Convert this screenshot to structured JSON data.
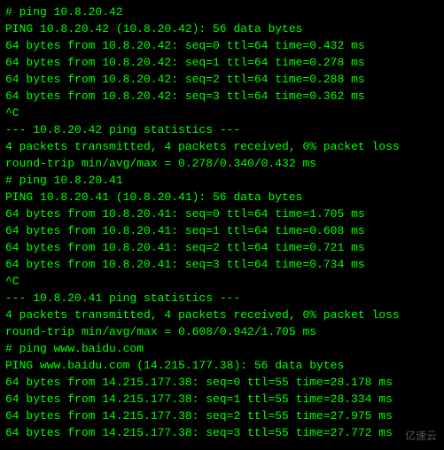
{
  "terminal": {
    "lines": [
      "# ping 10.8.20.42",
      "PING 10.8.20.42 (10.8.20.42): 56 data bytes",
      "64 bytes from 10.8.20.42: seq=0 ttl=64 time=0.432 ms",
      "64 bytes from 10.8.20.42: seq=1 ttl=64 time=0.278 ms",
      "64 bytes from 10.8.20.42: seq=2 ttl=64 time=0.288 ms",
      "64 bytes from 10.8.20.42: seq=3 ttl=64 time=0.362 ms",
      "^C",
      "--- 10.8.20.42 ping statistics ---",
      "4 packets transmitted, 4 packets received, 0% packet loss",
      "round-trip min/avg/max = 0.278/0.340/0.432 ms",
      "# ping 10.8.20.41",
      "PING 10.8.20.41 (10.8.20.41): 56 data bytes",
      "64 bytes from 10.8.20.41: seq=0 ttl=64 time=1.705 ms",
      "64 bytes from 10.8.20.41: seq=1 ttl=64 time=0.608 ms",
      "64 bytes from 10.8.20.41: seq=2 ttl=64 time=0.721 ms",
      "64 bytes from 10.8.20.41: seq=3 ttl=64 time=0.734 ms",
      "^C",
      "--- 10.8.20.41 ping statistics ---",
      "4 packets transmitted, 4 packets received, 0% packet loss",
      "round-trip min/avg/max = 0.608/0.942/1.705 ms",
      "# ping www.baidu.com",
      "PING www.baidu.com (14.215.177.38): 56 data bytes",
      "64 bytes from 14.215.177.38: seq=0 ttl=55 time=28.178 ms",
      "64 bytes from 14.215.177.38: seq=1 ttl=55 time=28.334 ms",
      "64 bytes from 14.215.177.38: seq=2 ttl=55 time=27.975 ms",
      "64 bytes from 14.215.177.38: seq=3 ttl=55 time=27.772 ms"
    ]
  },
  "watermark": {
    "text": "亿速云"
  }
}
